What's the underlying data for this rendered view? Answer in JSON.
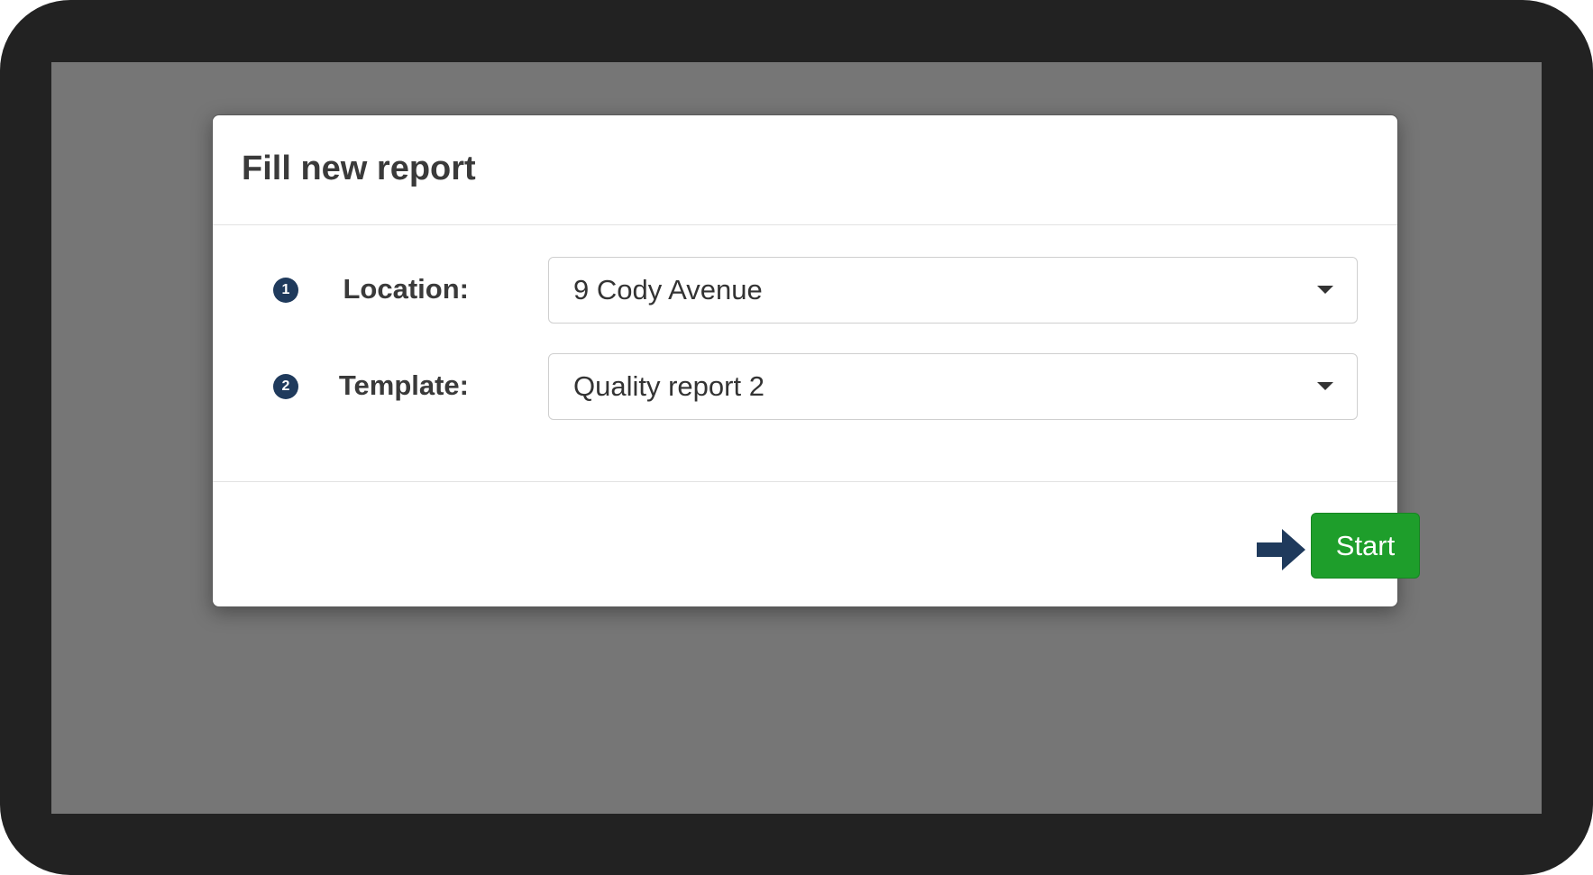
{
  "modal": {
    "title": "Fill new report"
  },
  "form": {
    "location": {
      "step": "1",
      "label": "Location:",
      "value": "9 Cody Avenue"
    },
    "template": {
      "step": "2",
      "label": "Template:",
      "value": "Quality report 2"
    }
  },
  "footer": {
    "start_label": "Start"
  },
  "colors": {
    "step_badge": "#1f3a5c",
    "start_button": "#1e9e2b",
    "arrow": "#1f3a5c",
    "overlay": "#767676"
  },
  "icons": {
    "dropdown": "caret-down-icon",
    "pointer": "arrow-right-icon"
  }
}
